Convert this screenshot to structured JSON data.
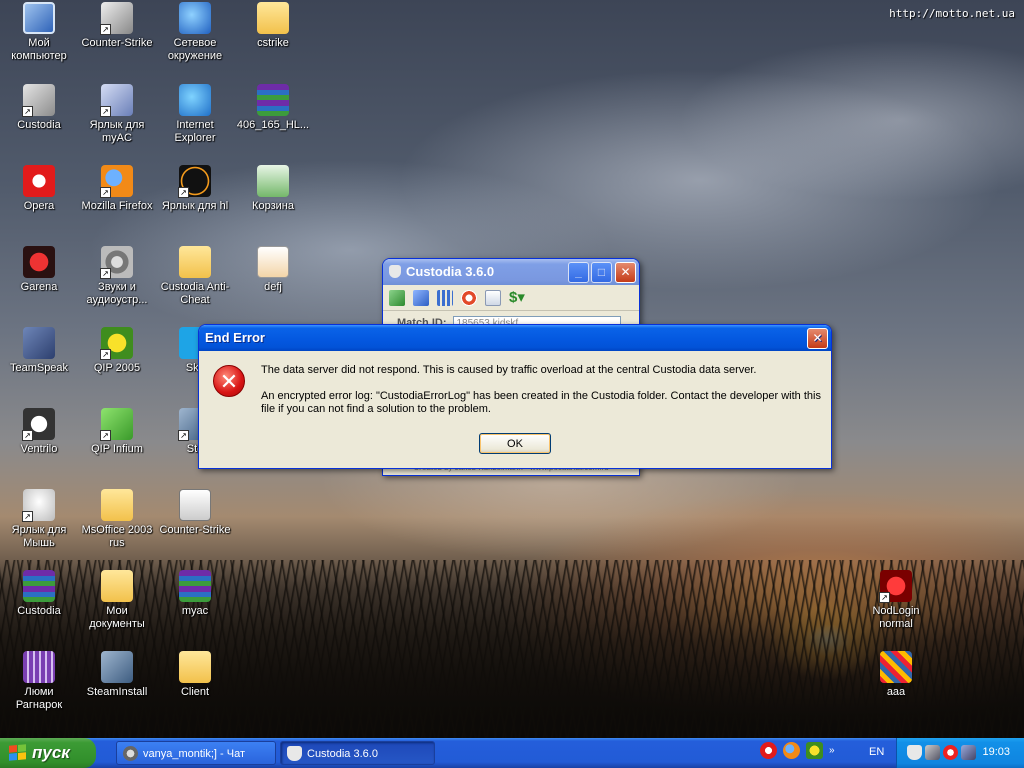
{
  "watermark": "http://motto.net.ua",
  "desktop_icons": [
    {
      "label": "Мой компьютер",
      "icon": "my-computer-icon"
    },
    {
      "label": "Counter-Strike",
      "icon": "counter-strike-icon"
    },
    {
      "label": "Сетевое окружение",
      "icon": "network-places-icon"
    },
    {
      "label": "cstrike",
      "icon": "folder-icon"
    },
    {
      "label": "Custodia",
      "icon": "custodia-shield-icon"
    },
    {
      "label": "Ярлык для myAC",
      "icon": "myac-shield-icon"
    },
    {
      "label": "Internet Explorer",
      "icon": "internet-explorer-icon"
    },
    {
      "label": "406_165_HL...",
      "icon": "winrar-archive-icon"
    },
    {
      "label": "Opera",
      "icon": "opera-icon"
    },
    {
      "label": "Mozilla Firefox",
      "icon": "firefox-icon"
    },
    {
      "label": "Ярлык для hl",
      "icon": "half-life-icon"
    },
    {
      "label": "Корзина",
      "icon": "recycle-bin-icon"
    },
    {
      "label": "Garena",
      "icon": "garena-icon"
    },
    {
      "label": "Звуки и аудиоустр...",
      "icon": "sound-devices-icon"
    },
    {
      "label": "Custodia Anti-Cheat",
      "icon": "folder-icon"
    },
    {
      "label": "defj",
      "icon": "image-file-icon"
    },
    {
      "label": "TeamSpeak",
      "icon": "teamspeak-icon"
    },
    {
      "label": "QIP 2005",
      "icon": "qip-icon"
    },
    {
      "label": "Sky",
      "icon": "skype-icon"
    },
    {
      "label": "Ventrilo",
      "icon": "ventrilo-icon"
    },
    {
      "label": "QIP Infium",
      "icon": "qip-infium-icon"
    },
    {
      "label": "Ste",
      "icon": "steam-icon"
    },
    {
      "label": "Ярлык для Мышь",
      "icon": "mouse-icon"
    },
    {
      "label": "MsOffice 2003 rus",
      "icon": "folder-icon"
    },
    {
      "label": "Counter-Strike",
      "icon": "cs-document-icon"
    },
    {
      "label": "Custodia",
      "icon": "winrar-archive-icon"
    },
    {
      "label": "Мои документы",
      "icon": "my-documents-icon"
    },
    {
      "label": "myac",
      "icon": "winrar-archive-icon"
    },
    {
      "label": "Люми Рагнарок",
      "icon": "lumi-ragnarok-icon"
    },
    {
      "label": "SteamInstall",
      "icon": "steam-install-icon"
    },
    {
      "label": "Client",
      "icon": "folder-icon"
    },
    {
      "label": "NodLogin normal",
      "icon": "nodlogin-icon"
    },
    {
      "label": "aaa",
      "icon": "aaa-archive-icon"
    }
  ],
  "custodia_window": {
    "title": "Custodia 3.6.0",
    "match_label": "Match ID:",
    "match_value": "185653 kjdskf",
    "footer": "Created by Jakob Kunzelmann · www.pocatthat.com.ru"
  },
  "error_dialog": {
    "title": "End Error",
    "message_line1": "The data server did not respond. This is caused by traffic overload at the central Custodia data server.",
    "message_line2": "An encrypted error log: \"CustodiaErrorLog\" has been created in the Custodia folder. Contact the developer with this file if you can not find a solution to the problem.",
    "ok_label": "OK"
  },
  "taskbar": {
    "start_label": "пуск",
    "buttons": [
      {
        "label": "vanya_montik;] - Чат",
        "icon": "chat-icon"
      },
      {
        "label": "Custodia 3.6.0",
        "icon": "custodia-shield-icon"
      }
    ],
    "language": "EN",
    "clock": "19:03"
  },
  "colors": {
    "titlebar_blue": "#0458e0",
    "start_green": "#3c9b35",
    "taskbar_blue": "#245edb",
    "error_red": "#d81414"
  }
}
